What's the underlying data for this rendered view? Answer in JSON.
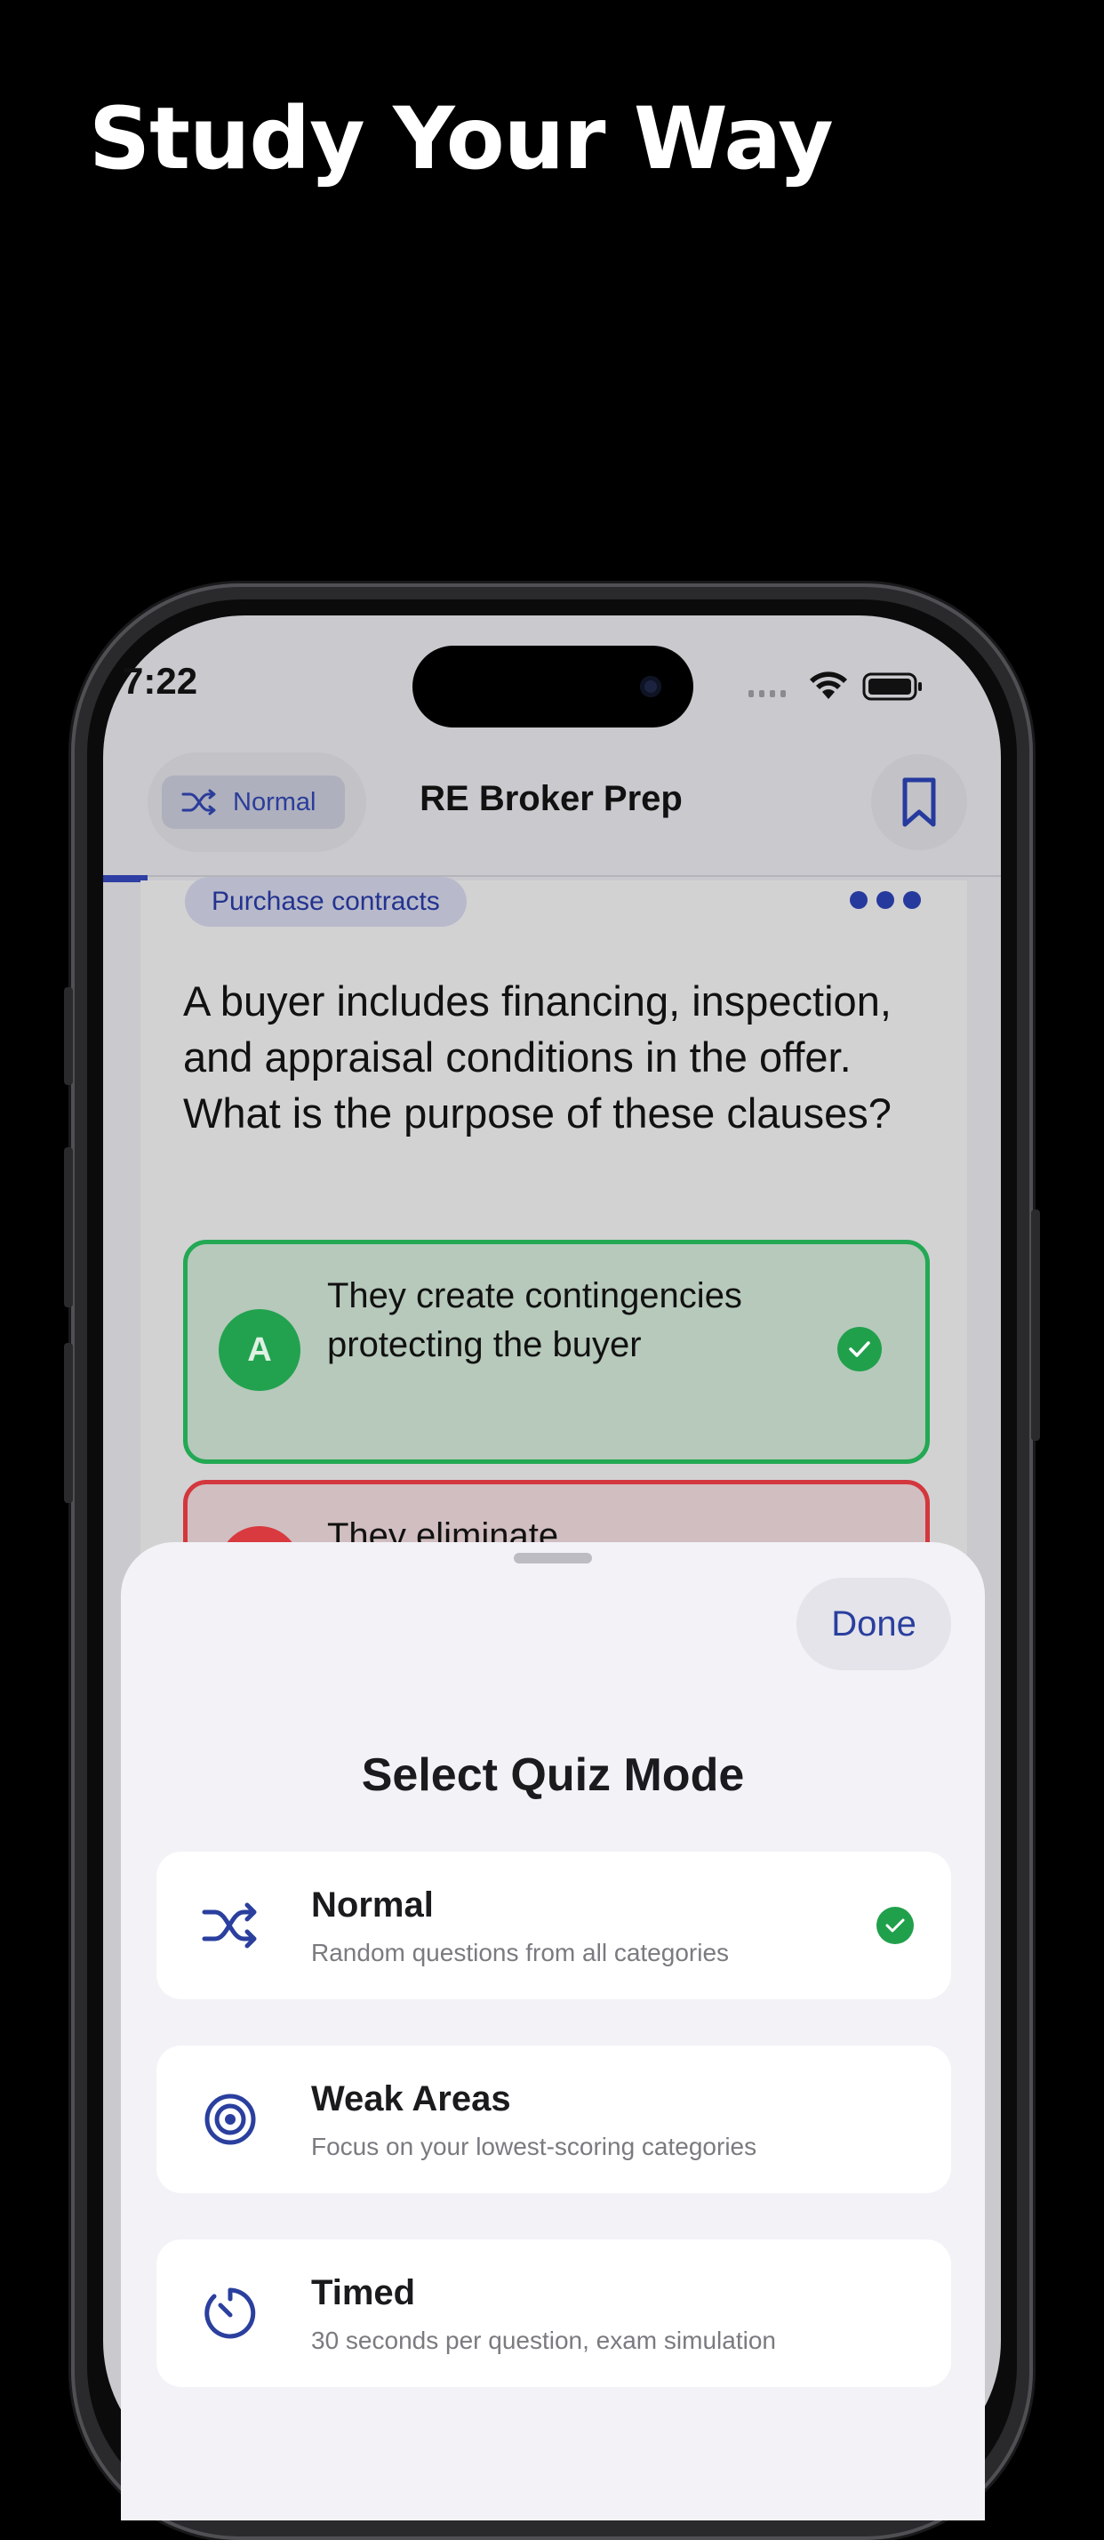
{
  "headline": "Study Your Way",
  "status_bar": {
    "time": "7:22"
  },
  "nav": {
    "mode_label": "Normal",
    "title": "RE Broker Prep"
  },
  "question_card": {
    "category": "Purchase contracts",
    "question": "A buyer includes financing, inspection, and appraisal conditions in the offer. What is the purpose of these clauses?",
    "answers": [
      {
        "letter": "A",
        "text": "They create contingencies protecting the buyer",
        "state": "correct"
      },
      {
        "letter": "",
        "text": "They eliminate",
        "state": "incorrect"
      }
    ]
  },
  "sheet": {
    "done_label": "Done",
    "title": "Select Quiz Mode",
    "modes": [
      {
        "name": "Normal",
        "description": "Random questions from all categories",
        "icon": "shuffle-icon",
        "selected": true
      },
      {
        "name": "Weak Areas",
        "description": "Focus on your lowest-scoring categories",
        "icon": "target-icon",
        "selected": false
      },
      {
        "name": "Timed",
        "description": "30 seconds per question, exam simulation",
        "icon": "timer-icon",
        "selected": false
      }
    ]
  },
  "colors": {
    "accent": "#2a3f9e",
    "correct": "#21a04c",
    "incorrect": "#d3373d",
    "background": "#000000",
    "sheet": "#f2f2f7"
  }
}
